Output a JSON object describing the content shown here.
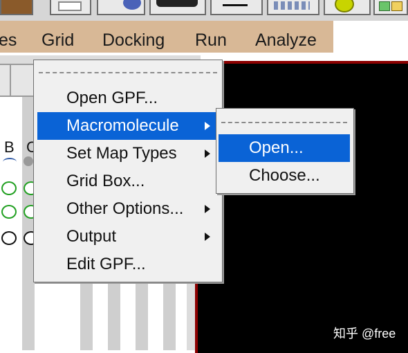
{
  "menubar": {
    "items": [
      {
        "label": "es"
      },
      {
        "label": "Grid"
      },
      {
        "label": "Docking"
      },
      {
        "label": "Run"
      },
      {
        "label": "Analyze"
      }
    ]
  },
  "grid_menu": {
    "items": [
      {
        "label": "Open GPF..."
      },
      {
        "label": "Macromolecule"
      },
      {
        "label": "Set Map Types"
      },
      {
        "label": "Grid Box..."
      },
      {
        "label": "Other Options..."
      },
      {
        "label": "Output"
      },
      {
        "label": "Edit GPF..."
      }
    ]
  },
  "macromolecule_submenu": {
    "items": [
      {
        "label": "Open..."
      },
      {
        "label": "Choose..."
      }
    ]
  },
  "panel": {
    "column_headers": [
      "B",
      "C"
    ]
  },
  "watermark": "知乎 @free",
  "colors": {
    "menubar": "#d8b896",
    "selection": "#0a63d6",
    "viewport_bg": "#000000",
    "viewport_border": "#8b0000",
    "oval_green": "#22a022"
  }
}
